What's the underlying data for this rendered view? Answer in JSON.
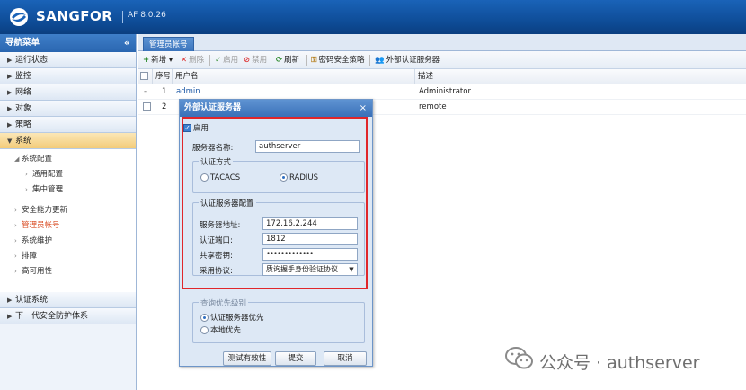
{
  "header": {
    "logo": "SANGFOR",
    "version": "AF 8.0.26"
  },
  "sidebar": {
    "title": "导航菜单",
    "collapse": "«",
    "items": [
      {
        "label": "运行状态"
      },
      {
        "label": "监控"
      },
      {
        "label": "网络"
      },
      {
        "label": "对象"
      },
      {
        "label": "策略"
      },
      {
        "label": "系统"
      }
    ],
    "system_sub": {
      "group": "系统配置",
      "group_items": [
        "通用配置",
        "集中管理"
      ],
      "items": [
        "安全能力更新",
        "管理员帐号",
        "系统维护",
        "排障",
        "高可用性"
      ]
    },
    "bottom_items": [
      {
        "label": "认证系统"
      },
      {
        "label": "下一代安全防护体系"
      }
    ]
  },
  "main": {
    "tab": "管理员帐号",
    "toolbar": {
      "add": "新增",
      "delete": "删除",
      "enable": "启用",
      "disable": "禁用",
      "refresh": "刷新",
      "pwd_policy": "密码安全策略",
      "ext_auth": "外部认证服务器"
    },
    "columns": {
      "seq": "序号",
      "user": "用户名",
      "desc": "描述"
    },
    "rows": [
      {
        "seq": "1",
        "user": "admin",
        "desc": "Administrator"
      },
      {
        "seq": "2",
        "user": "",
        "desc": "remote"
      }
    ]
  },
  "dialog": {
    "title": "外部认证服务器",
    "close": "×",
    "enable_label": "启用",
    "server_name_label": "服务器名称:",
    "server_name_value": "authserver",
    "auth_method_legend": "认证方式",
    "tacacs": "TACACS",
    "radius": "RADIUS",
    "config_legend": "认证服务器配置",
    "addr_label": "服务器地址:",
    "addr_value": "172.16.2.244",
    "port_label": "认证端口:",
    "port_value": "1812",
    "secret_label": "共享密钥:",
    "secret_value": "•••••••••••••",
    "protocol_label": "采用协议:",
    "protocol_value": "质询握手身份验证协议",
    "priority_legend": "查询优先级别",
    "priority_auth": "认证服务器优先",
    "priority_local": "本地优先",
    "btn_test": "测试有效性",
    "btn_submit": "提交",
    "btn_cancel": "取消"
  },
  "watermark": {
    "text": "公众号 · authserver"
  },
  "colors": {
    "header": "#0d4a94",
    "highlight": "#e0262a",
    "active_menu": "#d94b22"
  }
}
